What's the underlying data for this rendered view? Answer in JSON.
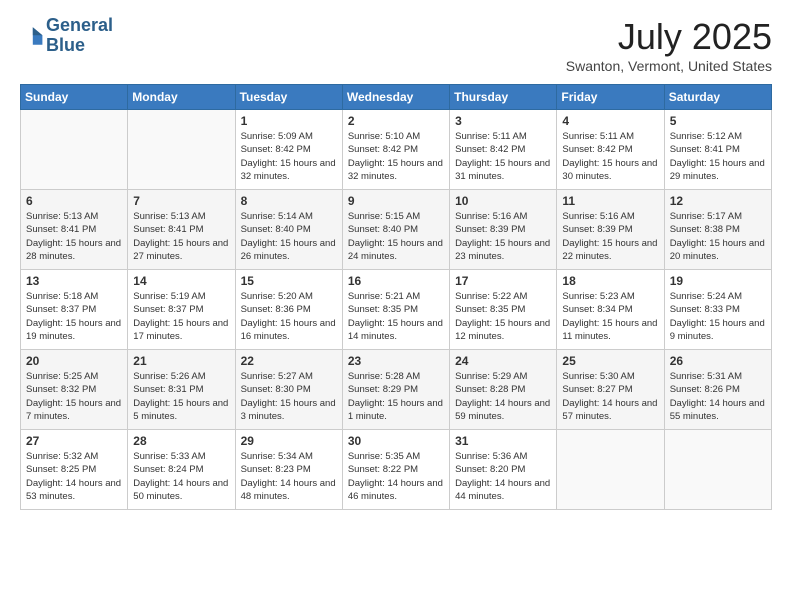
{
  "header": {
    "logo_line1": "General",
    "logo_line2": "Blue",
    "month_title": "July 2025",
    "location": "Swanton, Vermont, United States"
  },
  "days_of_week": [
    "Sunday",
    "Monday",
    "Tuesday",
    "Wednesday",
    "Thursday",
    "Friday",
    "Saturday"
  ],
  "weeks": [
    [
      {
        "day": "",
        "sunrise": "",
        "sunset": "",
        "daylight": ""
      },
      {
        "day": "",
        "sunrise": "",
        "sunset": "",
        "daylight": ""
      },
      {
        "day": "1",
        "sunrise": "Sunrise: 5:09 AM",
        "sunset": "Sunset: 8:42 PM",
        "daylight": "Daylight: 15 hours and 32 minutes."
      },
      {
        "day": "2",
        "sunrise": "Sunrise: 5:10 AM",
        "sunset": "Sunset: 8:42 PM",
        "daylight": "Daylight: 15 hours and 32 minutes."
      },
      {
        "day": "3",
        "sunrise": "Sunrise: 5:11 AM",
        "sunset": "Sunset: 8:42 PM",
        "daylight": "Daylight: 15 hours and 31 minutes."
      },
      {
        "day": "4",
        "sunrise": "Sunrise: 5:11 AM",
        "sunset": "Sunset: 8:42 PM",
        "daylight": "Daylight: 15 hours and 30 minutes."
      },
      {
        "day": "5",
        "sunrise": "Sunrise: 5:12 AM",
        "sunset": "Sunset: 8:41 PM",
        "daylight": "Daylight: 15 hours and 29 minutes."
      }
    ],
    [
      {
        "day": "6",
        "sunrise": "Sunrise: 5:13 AM",
        "sunset": "Sunset: 8:41 PM",
        "daylight": "Daylight: 15 hours and 28 minutes."
      },
      {
        "day": "7",
        "sunrise": "Sunrise: 5:13 AM",
        "sunset": "Sunset: 8:41 PM",
        "daylight": "Daylight: 15 hours and 27 minutes."
      },
      {
        "day": "8",
        "sunrise": "Sunrise: 5:14 AM",
        "sunset": "Sunset: 8:40 PM",
        "daylight": "Daylight: 15 hours and 26 minutes."
      },
      {
        "day": "9",
        "sunrise": "Sunrise: 5:15 AM",
        "sunset": "Sunset: 8:40 PM",
        "daylight": "Daylight: 15 hours and 24 minutes."
      },
      {
        "day": "10",
        "sunrise": "Sunrise: 5:16 AM",
        "sunset": "Sunset: 8:39 PM",
        "daylight": "Daylight: 15 hours and 23 minutes."
      },
      {
        "day": "11",
        "sunrise": "Sunrise: 5:16 AM",
        "sunset": "Sunset: 8:39 PM",
        "daylight": "Daylight: 15 hours and 22 minutes."
      },
      {
        "day": "12",
        "sunrise": "Sunrise: 5:17 AM",
        "sunset": "Sunset: 8:38 PM",
        "daylight": "Daylight: 15 hours and 20 minutes."
      }
    ],
    [
      {
        "day": "13",
        "sunrise": "Sunrise: 5:18 AM",
        "sunset": "Sunset: 8:37 PM",
        "daylight": "Daylight: 15 hours and 19 minutes."
      },
      {
        "day": "14",
        "sunrise": "Sunrise: 5:19 AM",
        "sunset": "Sunset: 8:37 PM",
        "daylight": "Daylight: 15 hours and 17 minutes."
      },
      {
        "day": "15",
        "sunrise": "Sunrise: 5:20 AM",
        "sunset": "Sunset: 8:36 PM",
        "daylight": "Daylight: 15 hours and 16 minutes."
      },
      {
        "day": "16",
        "sunrise": "Sunrise: 5:21 AM",
        "sunset": "Sunset: 8:35 PM",
        "daylight": "Daylight: 15 hours and 14 minutes."
      },
      {
        "day": "17",
        "sunrise": "Sunrise: 5:22 AM",
        "sunset": "Sunset: 8:35 PM",
        "daylight": "Daylight: 15 hours and 12 minutes."
      },
      {
        "day": "18",
        "sunrise": "Sunrise: 5:23 AM",
        "sunset": "Sunset: 8:34 PM",
        "daylight": "Daylight: 15 hours and 11 minutes."
      },
      {
        "day": "19",
        "sunrise": "Sunrise: 5:24 AM",
        "sunset": "Sunset: 8:33 PM",
        "daylight": "Daylight: 15 hours and 9 minutes."
      }
    ],
    [
      {
        "day": "20",
        "sunrise": "Sunrise: 5:25 AM",
        "sunset": "Sunset: 8:32 PM",
        "daylight": "Daylight: 15 hours and 7 minutes."
      },
      {
        "day": "21",
        "sunrise": "Sunrise: 5:26 AM",
        "sunset": "Sunset: 8:31 PM",
        "daylight": "Daylight: 15 hours and 5 minutes."
      },
      {
        "day": "22",
        "sunrise": "Sunrise: 5:27 AM",
        "sunset": "Sunset: 8:30 PM",
        "daylight": "Daylight: 15 hours and 3 minutes."
      },
      {
        "day": "23",
        "sunrise": "Sunrise: 5:28 AM",
        "sunset": "Sunset: 8:29 PM",
        "daylight": "Daylight: 15 hours and 1 minute."
      },
      {
        "day": "24",
        "sunrise": "Sunrise: 5:29 AM",
        "sunset": "Sunset: 8:28 PM",
        "daylight": "Daylight: 14 hours and 59 minutes."
      },
      {
        "day": "25",
        "sunrise": "Sunrise: 5:30 AM",
        "sunset": "Sunset: 8:27 PM",
        "daylight": "Daylight: 14 hours and 57 minutes."
      },
      {
        "day": "26",
        "sunrise": "Sunrise: 5:31 AM",
        "sunset": "Sunset: 8:26 PM",
        "daylight": "Daylight: 14 hours and 55 minutes."
      }
    ],
    [
      {
        "day": "27",
        "sunrise": "Sunrise: 5:32 AM",
        "sunset": "Sunset: 8:25 PM",
        "daylight": "Daylight: 14 hours and 53 minutes."
      },
      {
        "day": "28",
        "sunrise": "Sunrise: 5:33 AM",
        "sunset": "Sunset: 8:24 PM",
        "daylight": "Daylight: 14 hours and 50 minutes."
      },
      {
        "day": "29",
        "sunrise": "Sunrise: 5:34 AM",
        "sunset": "Sunset: 8:23 PM",
        "daylight": "Daylight: 14 hours and 48 minutes."
      },
      {
        "day": "30",
        "sunrise": "Sunrise: 5:35 AM",
        "sunset": "Sunset: 8:22 PM",
        "daylight": "Daylight: 14 hours and 46 minutes."
      },
      {
        "day": "31",
        "sunrise": "Sunrise: 5:36 AM",
        "sunset": "Sunset: 8:20 PM",
        "daylight": "Daylight: 14 hours and 44 minutes."
      },
      {
        "day": "",
        "sunrise": "",
        "sunset": "",
        "daylight": ""
      },
      {
        "day": "",
        "sunrise": "",
        "sunset": "",
        "daylight": ""
      }
    ]
  ]
}
